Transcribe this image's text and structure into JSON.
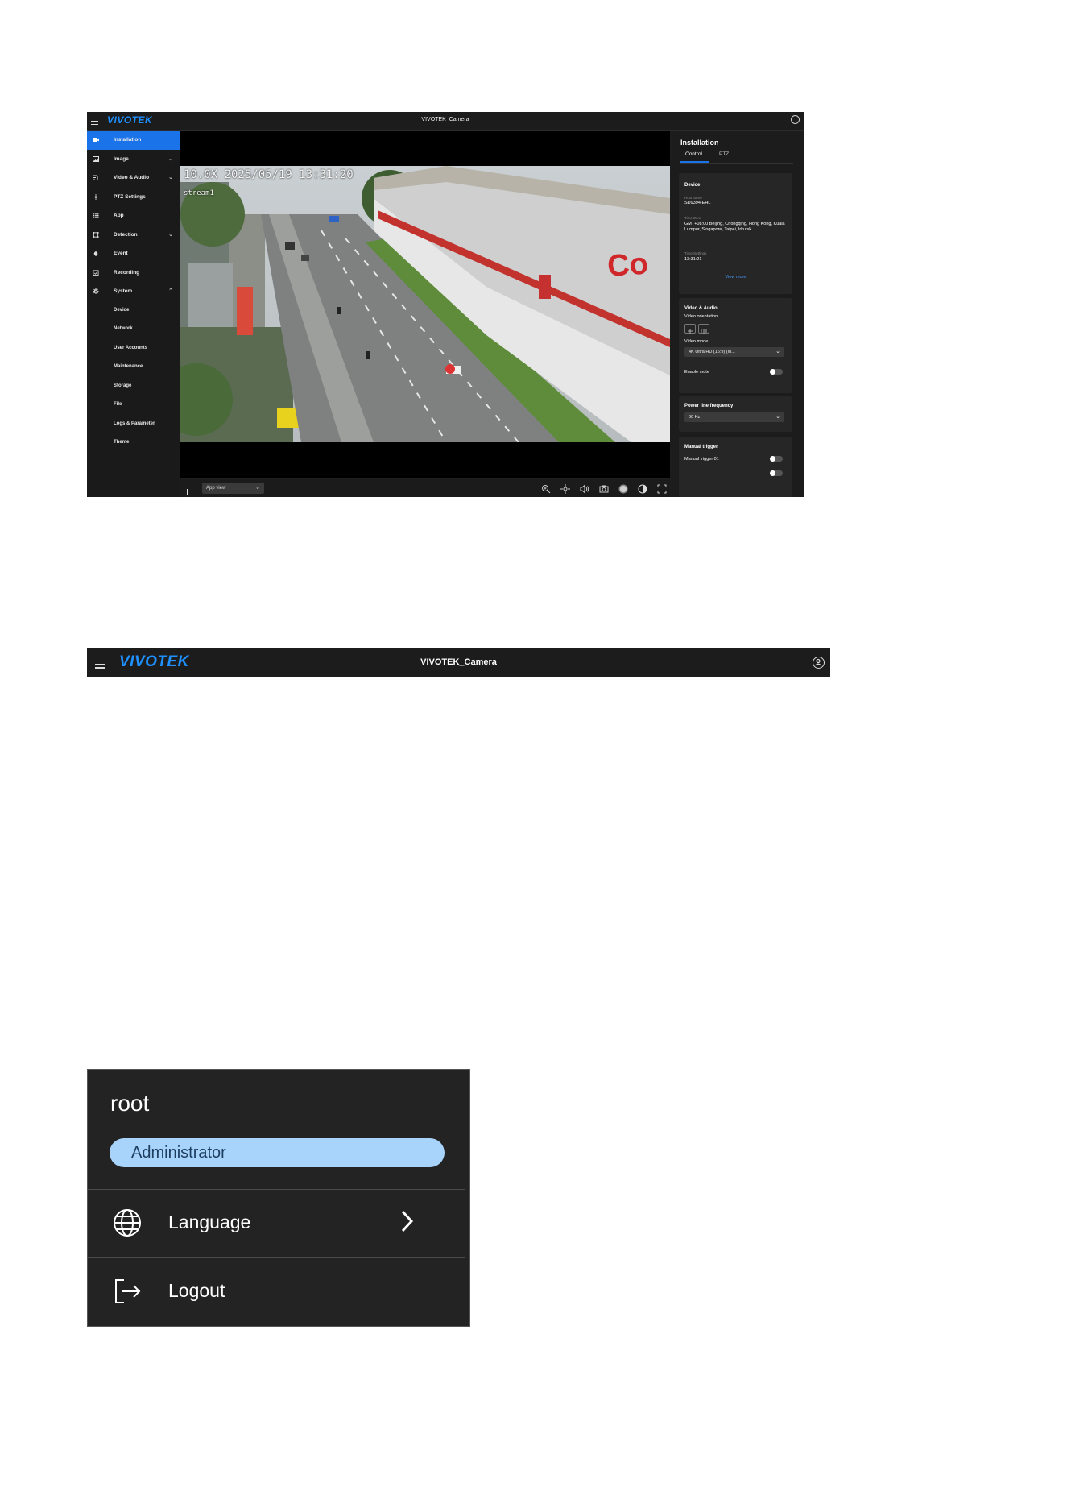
{
  "app": {
    "logo": "VIVOTEK",
    "title": "VIVOTEK_Camera"
  },
  "sidebar": {
    "items": [
      {
        "label": "Installation",
        "icon": "camera-icon",
        "active": true
      },
      {
        "label": "Image",
        "icon": "image-icon",
        "expandable": true
      },
      {
        "label": "Video & Audio",
        "icon": "video-audio-icon",
        "expandable": true
      },
      {
        "label": "PTZ Settings",
        "icon": "ptz-icon"
      },
      {
        "label": "App",
        "icon": "apps-grid-icon"
      },
      {
        "label": "Detection",
        "icon": "detection-icon",
        "expandable": true
      },
      {
        "label": "Event",
        "icon": "bell-icon"
      },
      {
        "label": "Recording",
        "icon": "calendar-check-icon"
      },
      {
        "label": "System",
        "icon": "gear-icon",
        "expanded": true
      }
    ],
    "system_sub_items": [
      "Device",
      "Network",
      "User Accounts",
      "Maintenance",
      "Storage",
      "File",
      "Logs & Parameter",
      "Theme"
    ]
  },
  "video": {
    "osd_line1": "10.0X 2025/05/19 13:31:20",
    "osd_line2": "stream1",
    "view_select": "App view",
    "toolbar_icons": [
      "zoom-icon",
      "ptz-move-icon",
      "volume-icon",
      "snapshot-icon",
      "record-dot-icon",
      "contrast-icon",
      "fullscreen-icon"
    ]
  },
  "panel": {
    "title": "Installation",
    "tabs": [
      "Control",
      "PTZ"
    ],
    "device": {
      "heading": "Device",
      "host_name_label": "Host name",
      "host_name": "SD9394-EHL",
      "time_zone_label": "Time Zone",
      "time_zone": "GMT+08:00 Beijing, Chongqing, Hong Kong, Kuala Lumpur, Singapore, Taipei, Irkutsk",
      "time_settings_label": "Time Settings",
      "time": "13:31:21",
      "view_more": "View more"
    },
    "video_audio": {
      "heading": "Video & Audio",
      "orientation_label": "Video orientation",
      "mode_label": "Video mode",
      "mode_value": "4K Ultra HD (16:9) (M...",
      "mute_label": "Enable mute"
    },
    "power": {
      "heading": "Power line frequency",
      "value": "60 Hz"
    },
    "manual_trigger": {
      "heading": "Manual trigger",
      "item": "Manual trigger 01"
    }
  },
  "user_menu": {
    "username": "root",
    "role": "Administrator",
    "language": "Language",
    "logout": "Logout"
  },
  "colors": {
    "accent": "#1a73e8",
    "logo": "#1e90ff",
    "role_badge": "#a8d4fc"
  }
}
